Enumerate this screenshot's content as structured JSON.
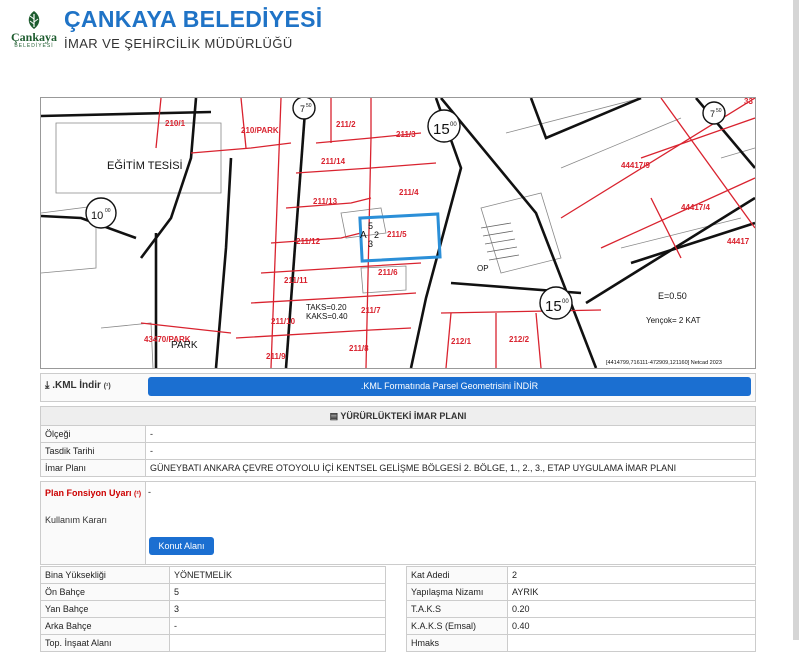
{
  "header": {
    "title": "ÇANKAYA BELEDİYESİ",
    "subtitle": "İMAR VE ŞEHİRCİLİK MÜDÜRLÜĞÜ",
    "logo_text": "Çankaya",
    "logo_subtext": "BELEDİYESİ"
  },
  "map": {
    "labels": {
      "egitim": "EĞİTİM TESİSİ",
      "park": "PARK",
      "p210_1": "210/1",
      "p210_park": "210/PARK",
      "p211_2": "211/2",
      "p211_3": "211/3",
      "p211_14": "211/14",
      "p211_4": "211/4",
      "p211_13": "211/13",
      "p211_5": "211/5",
      "p211_12": "211/12",
      "p211_6": "211/6",
      "p211_11": "211/11",
      "p211_7": "211/7",
      "p211_10": "211/10",
      "p211_8": "211/8",
      "p211_9": "211/9",
      "p212_1": "212/1",
      "p212_2": "212/2",
      "p43470": "43470/PARK",
      "p44417_9": "44417/9",
      "p44417_4": "44417/4",
      "p44417_edge": "44417",
      "ro15a": "15",
      "ro15b": "15",
      "ro10": "10",
      "ro7a": "7",
      "ro7b": "7",
      "sup": "00",
      "sup50": "50",
      "taks": "TAKS=0.20",
      "kaks": "KAKS=0.40",
      "a_symbol": "A",
      "a_top": "5",
      "a_mid": "2",
      "a_bot": "3",
      "e_value": "E=0.50",
      "yencok": "Yençok= 2 KAT",
      "op": "OP",
      "n33": "33",
      "coords": "[4414799,716111-472909,121160] Netcad 2023"
    }
  },
  "kml": {
    "label": ".KML İndir",
    "info_mark": "(¹)",
    "button": ".KML Formatında Parsel Geometrisini İNDİR"
  },
  "plan": {
    "heading": "YÜRÜRLÜKTEKİ İMAR PLANI",
    "rows": [
      {
        "label": "Ölçeği",
        "value": "-"
      },
      {
        "label": "Tasdik Tarihi",
        "value": "-"
      },
      {
        "label": "İmar Planı",
        "value": "GÜNEYBATI ANKARA ÇEVRE OTOYOLU İÇİ KENTSEL GELİŞME BÖLGESİ 2. BÖLGE, 1., 2., 3., ETAP UYGULAMA İMAR PLANI"
      }
    ]
  },
  "uyari": {
    "label": "Plan Fonsiyon Uyarı",
    "mark": "(²)",
    "value": "-",
    "kullanim_label": "Kullanım Kararı",
    "kullanim_button": "Konut Alanı"
  },
  "left_table": [
    {
      "label": "Bina Yüksekliği",
      "value": "YÖNETMELİK"
    },
    {
      "label": "Ön Bahçe",
      "value": "5"
    },
    {
      "label": "Yan Bahçe",
      "value": "3"
    },
    {
      "label": "Arka Bahçe",
      "value": "-"
    },
    {
      "label": "Top. İnşaat Alanı",
      "value": ""
    }
  ],
  "right_table": [
    {
      "label": "Kat Adedi",
      "value": "2"
    },
    {
      "label": "Yapılaşma Nizamı",
      "value": "AYRIK"
    },
    {
      "label": "T.A.K.S",
      "value": "0.20"
    },
    {
      "label": "K.A.K.S (Emsal)",
      "value": "0.40"
    },
    {
      "label": "Hmaks",
      "value": ""
    }
  ],
  "colors": {
    "accent": "#1b6fd1",
    "title": "#1f73c6",
    "parcel": "#d9232f",
    "highlight": "#2b8fd8",
    "logo_green": "#1e5c2f"
  }
}
